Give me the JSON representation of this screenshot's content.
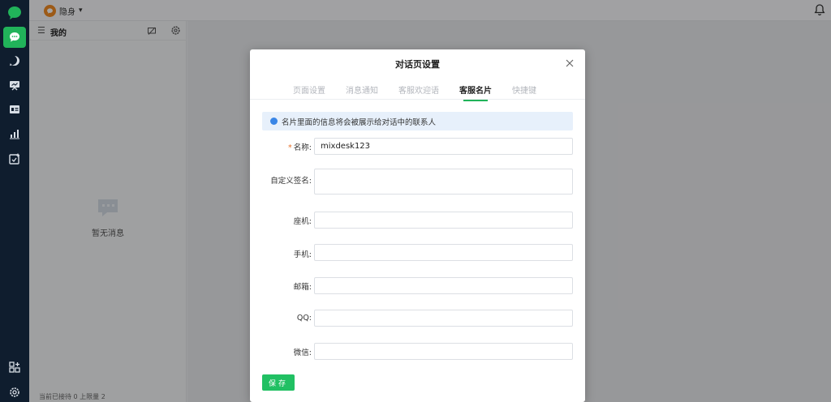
{
  "topbar": {
    "status_label": "隐身",
    "status_caret": "▾"
  },
  "panel": {
    "title": "我的",
    "menu_glyph": "☰",
    "empty_text": "暂无消息",
    "footer": "当前已接待 0 上限量 2"
  },
  "dialog": {
    "title": "对话页设置",
    "tabs": [
      "页面设置",
      "消息通知",
      "客服欢迎语",
      "客服名片",
      "快捷键"
    ],
    "active_tab": "客服名片",
    "notice": "名片里面的信息将会被展示给对话中的联系人",
    "form": {
      "name": {
        "label": "名称:",
        "required_mark": "*",
        "value": "mixdesk123"
      },
      "signature": {
        "label": "自定义签名:",
        "value": ""
      },
      "landline": {
        "label": "座机:",
        "value": ""
      },
      "mobile": {
        "label": "手机:",
        "value": ""
      },
      "email": {
        "label": "邮箱:",
        "value": ""
      },
      "qq": {
        "label": "QQ:",
        "value": ""
      },
      "wechat": {
        "label": "微信:",
        "value": ""
      }
    },
    "save_label": "保存"
  },
  "colors": {
    "brand_green": "#21b35a",
    "rail_bg": "#0f1d2e",
    "notice_bg": "#e7f0fb",
    "info_blue": "#3a86e6",
    "required": "#e6702a"
  },
  "icons": [
    "logo-icon",
    "chat-icon",
    "history-icon",
    "monitor-icon",
    "contact-card-icon",
    "stats-icon",
    "ticket-icon",
    "apps-icon",
    "settings-icon",
    "bell-icon",
    "close-icon"
  ]
}
